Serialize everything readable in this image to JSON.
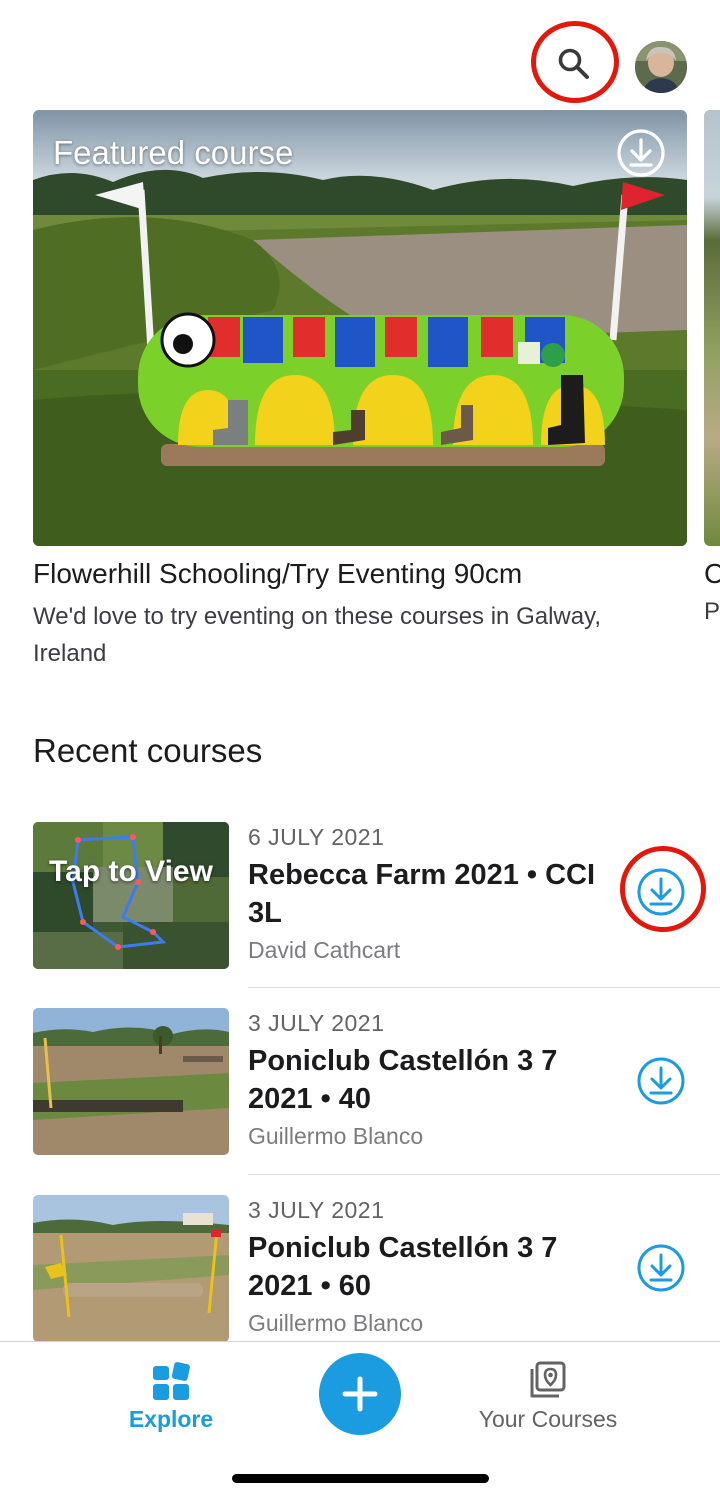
{
  "header": {
    "search_icon": "search-icon",
    "avatar_icon": "user-avatar"
  },
  "featured": {
    "label": "Featured course",
    "title": "Flowerhill Schooling/Try Eventing 90cm",
    "description": "We'd love to try eventing on these courses in Galway, Ireland",
    "download_icon": "download-icon",
    "next_peek_title": "C",
    "next_peek_desc": "P"
  },
  "recent": {
    "section_title": "Recent courses",
    "items": [
      {
        "date": "6 JULY 2021",
        "title": "Rebecca Farm 2021 • CCI 3L",
        "author": "David Cathcart",
        "thumb_overlay": "Tap to View",
        "download_icon": "download-icon"
      },
      {
        "date": "3 JULY 2021",
        "title": "Poniclub Castellón 3 7 2021 • 40",
        "author": "Guillermo Blanco",
        "download_icon": "download-icon"
      },
      {
        "date": "3 JULY 2021",
        "title": "Poniclub Castellón 3 7 2021 • 60",
        "author": "Guillermo Blanco",
        "download_icon": "download-icon"
      }
    ]
  },
  "tabbar": {
    "explore_label": "Explore",
    "courses_label": "Your Courses",
    "add_icon": "plus-icon"
  },
  "colors": {
    "accent": "#1b9be0",
    "highlight_ring": "#e3170a"
  }
}
